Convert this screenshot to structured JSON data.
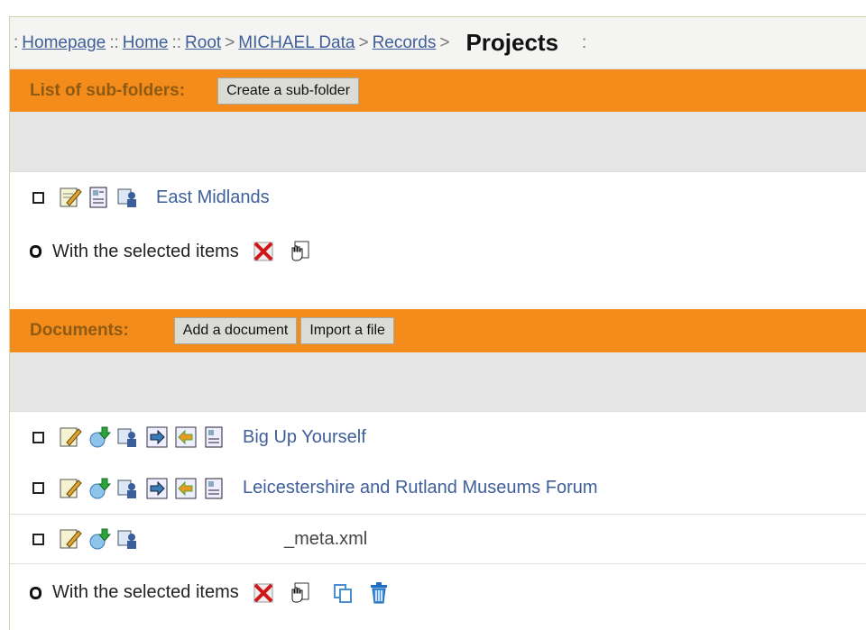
{
  "breadcrumb": {
    "homepage": "Homepage",
    "home": "Home",
    "root": "Root",
    "michael": "MICHAEL Data",
    "records": "Records",
    "current": "Projects",
    "sep_colons": "::",
    "sep_arrow": ">",
    "sep_start": ":",
    "sep_end": ":"
  },
  "subfolders": {
    "title": "List of sub-folders:",
    "create_button": "Create a sub-folder",
    "items": [
      {
        "name": "East Midlands"
      }
    ],
    "selected_label": "With the selected items"
  },
  "documents": {
    "title": "Documents:",
    "add_button": "Add a document",
    "import_button": "Import a file",
    "items": [
      {
        "name": "Big Up Yourself"
      },
      {
        "name": "Leicestershire and Rutland Museums Forum"
      },
      {
        "name": "_meta.xml"
      }
    ],
    "selected_label": "With the selected items"
  },
  "colors": {
    "accent": "#f38c1a",
    "title_text": "#8f5a12",
    "link": "#3f5f9a"
  }
}
